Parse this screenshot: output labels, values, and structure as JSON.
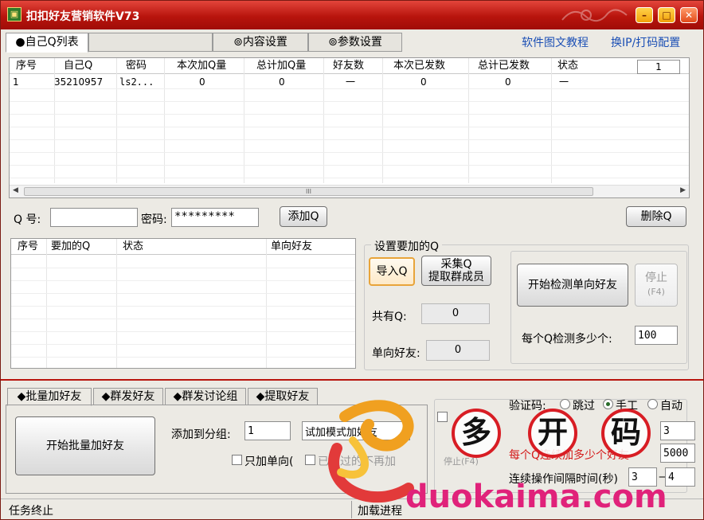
{
  "window": {
    "title": "扣扣好友营销软件V73",
    "icon_name": "app-seal-icon"
  },
  "top_tabs": [
    {
      "label": "●自己Q列表",
      "active": true
    },
    {
      "label": "",
      "active": false
    },
    {
      "label": "⊚内容设置",
      "active": false
    },
    {
      "label": "⊚参数设置",
      "active": false
    }
  ],
  "top_links": {
    "tutorial": "软件图文教程",
    "change_ip": "换IP/打码配置"
  },
  "account_grid": {
    "columns": [
      "序号",
      "自己Q",
      "密码",
      "本次加Q量",
      "总计加Q量",
      "好友数",
      "本次已发数",
      "总计已发数",
      "状态"
    ],
    "spin_value": "1",
    "rows": [
      [
        "1",
        "35210957",
        "ls2...",
        "0",
        "0",
        "一",
        "0",
        "0",
        "一"
      ]
    ],
    "scroll_thumb_glyph": "III"
  },
  "account_form": {
    "qq_label": "Q 号:",
    "qq_value": "",
    "password_label": "密码:",
    "password_value": "*********",
    "add_button": "添加Q",
    "delete_button": "删除Q"
  },
  "target_grid": {
    "columns": [
      "序号",
      "要加的Q",
      "状态",
      "单向好友"
    ]
  },
  "target_settings": {
    "group_title": "设置要加的Q",
    "import_button": "导入Q",
    "collect_button_line1": "采集Q",
    "collect_button_line2": "提取群成员",
    "total_label": "共有Q:",
    "total_value": "0",
    "oneway_label": "单向好友:",
    "oneway_value": "0",
    "start_check_button": "开始检测单向好友",
    "stop_button_line1": "停止",
    "stop_button_line2": "(F4)",
    "per_check_label": "每个Q检测多少个:",
    "per_check_value": "100"
  },
  "bottom_tabs": [
    {
      "label": "◆批量加好友",
      "active": true
    },
    {
      "label": "◆群发好友",
      "active": false
    },
    {
      "label": "◆群发讨论组",
      "active": false
    },
    {
      "label": "◆提取好友",
      "active": false
    }
  ],
  "batch_add": {
    "start_button": "开始批量加好友",
    "group_label": "添加到分组:",
    "group_value": "1",
    "mode_value": "试加模式加好友",
    "oneway_only_label": "只加单向(",
    "obscured_option_label": "已发过的不再加"
  },
  "verification": {
    "label": "验证码:",
    "options": [
      "跳过",
      "手工",
      "自动"
    ],
    "selected": "手工",
    "row1_value": "3",
    "row2_label": "每个Q连续加多少个好友",
    "row2_value": "5000",
    "interval_label": "连续操作间隔时间(秒)",
    "interval_from": "3",
    "interval_sep": "—",
    "interval_to": "4",
    "stop_hint": "停止(F4)"
  },
  "status": {
    "left": "任务终止",
    "right": "加载进程"
  },
  "watermark": {
    "chars": [
      "多",
      "开",
      "码"
    ],
    "url": "duokaima.com"
  },
  "colors": {
    "titlebar": "#b8140d",
    "link": "#1b4fb5",
    "accent_orange": "#e8a43a",
    "watermark_red": "#d81d24",
    "watermark_pink": "#e0227a"
  }
}
